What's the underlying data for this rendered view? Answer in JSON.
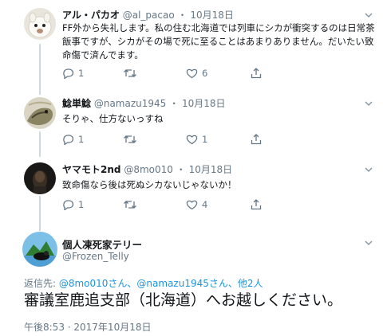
{
  "tweets": [
    {
      "name": "アル・パカオ",
      "handle": "@al_pacao",
      "separator": "・",
      "date": "10月18日",
      "text": "FF外から失礼します。私の住む北海道では列車にシカが衝突するのは日常茶飯事ですが、シカがその場で死に至ることはあまりありません。だいたい致命傷で済んでます。",
      "reply_count": "1",
      "retweet_count": "",
      "like_count": "6"
    },
    {
      "name": "鯰単鯰",
      "handle": "@namazu1945",
      "separator": "・",
      "date": "10月18日",
      "text": "そりゃ、仕方ないっすね",
      "reply_count": "1",
      "retweet_count": "",
      "like_count": "1"
    },
    {
      "name": "ヤマモト2nd",
      "handle": "@8mo010",
      "separator": "・",
      "date": "10月18日",
      "text": "致命傷なら後は死ぬシカないじゃないか！",
      "reply_count": "1",
      "retweet_count": "",
      "like_count": "4"
    }
  ],
  "main_tweet": {
    "name": "個人凍死家テリー",
    "handle": "@Frozen_Telly",
    "reply_prefix": "返信先: ",
    "reply_users": "@8mo010さん、@namazu1945さん、他2人",
    "text": "審議室鹿追支部（北海道）へお越しください。",
    "timestamp": "午後8:53 · 2017年10月18日"
  },
  "icons": {
    "reply": "reply-icon",
    "retweet": "retweet-icon",
    "like": "heart-icon",
    "share": "share-icon",
    "more": "chevron-down-icon"
  },
  "colors": {
    "link": "#1b95e0",
    "secondary": "#657786",
    "thread_line": "#cfd9de"
  }
}
